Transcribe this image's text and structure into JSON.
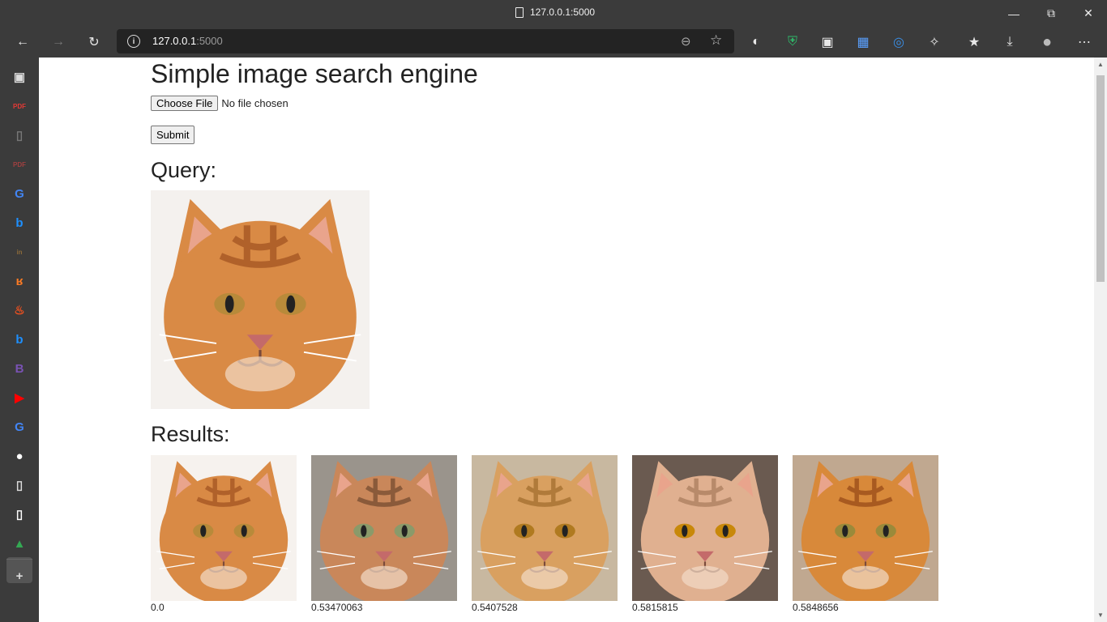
{
  "browser": {
    "tab_title": "127.0.0.1:5000",
    "url_host": "127.0.0.1",
    "url_port": ":5000",
    "window_controls": [
      "minimize-icon",
      "restore-icon",
      "close-icon"
    ]
  },
  "sidebar": {
    "items": [
      {
        "name": "tab-actions-icon",
        "color": "#dcdcdc",
        "glyph": "▣"
      },
      {
        "name": "pdf-icon",
        "color": "#e53935",
        "glyph": "PDF"
      },
      {
        "name": "file-icon",
        "color": "#777777",
        "glyph": "▯"
      },
      {
        "name": "pdf-icon-dim",
        "color": "#a04040",
        "glyph": "PDF"
      },
      {
        "name": "google-icon",
        "color": "#4285f4",
        "glyph": "G"
      },
      {
        "name": "bing-icon",
        "color": "#1e90ff",
        "glyph": "b"
      },
      {
        "name": "in-icon",
        "color": "#8a6a3a",
        "glyph": "in"
      },
      {
        "name": "xampp-icon",
        "color": "#fb7a24",
        "glyph": "ʁ"
      },
      {
        "name": "codepen-icon",
        "color": "#f4511e",
        "glyph": "♨"
      },
      {
        "name": "bing-icon-2",
        "color": "#1e90ff",
        "glyph": "b"
      },
      {
        "name": "bootstrap-icon",
        "color": "#7952b3",
        "glyph": "B"
      },
      {
        "name": "youtube-icon",
        "color": "#ff0000",
        "glyph": "▶"
      },
      {
        "name": "translate-icon",
        "color": "#4285f4",
        "glyph": "G"
      },
      {
        "name": "github-icon",
        "color": "#ffffff",
        "glyph": "●"
      },
      {
        "name": "document-icon",
        "color": "#dcdcdc",
        "glyph": "▯"
      },
      {
        "name": "document-icon-selected",
        "color": "#ffffff",
        "glyph": "▯"
      },
      {
        "name": "drive-icon",
        "color": "#34a853",
        "glyph": "▲"
      },
      {
        "name": "add-icon",
        "color": "#dcdcdc",
        "glyph": "+"
      }
    ]
  },
  "page": {
    "title": "Simple image search engine",
    "choose_file_label": "Choose File",
    "no_file_text": "No file chosen",
    "submit_label": "Submit",
    "query_heading": "Query:",
    "results_heading": "Results:",
    "results": [
      {
        "score": "0.0"
      },
      {
        "score": "0.53470063"
      },
      {
        "score": "0.5407528"
      },
      {
        "score": "0.5815815"
      },
      {
        "score": "0.5848656"
      }
    ]
  }
}
